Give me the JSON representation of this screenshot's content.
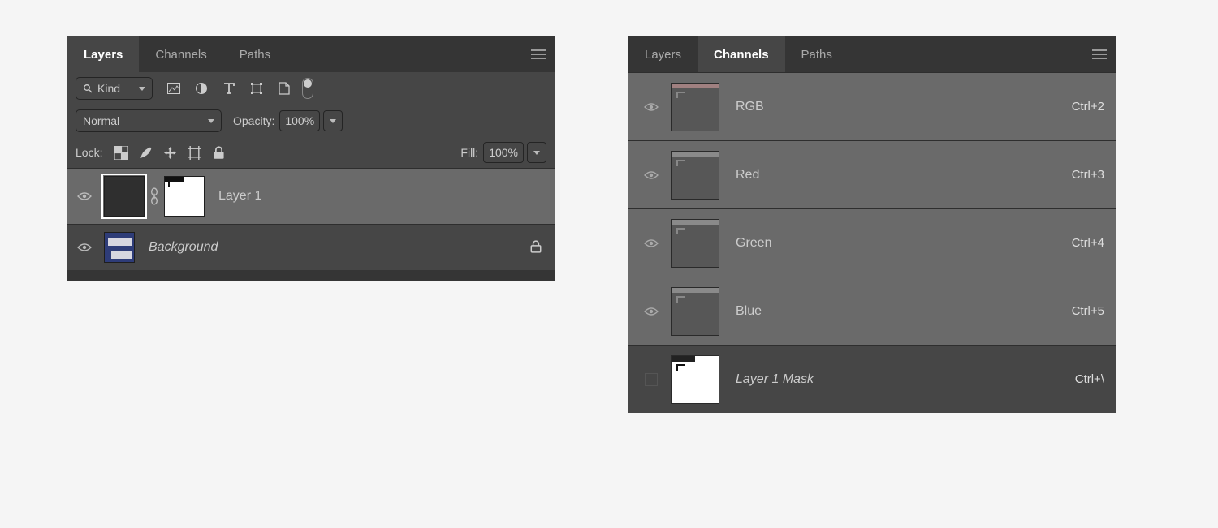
{
  "left": {
    "tabs": [
      "Layers",
      "Channels",
      "Paths"
    ],
    "active_tab_index": 0,
    "filter": {
      "kind_label": "Kind",
      "pixel_icon": "pixel-layer-icon",
      "adjust_icon": "adjustment-layer-icon",
      "type_icon": "type-layer-icon",
      "shape_icon": "shape-layer-icon",
      "smart_icon": "smart-object-icon"
    },
    "blend_row": {
      "mode": "Normal",
      "opacity_label": "Opacity:",
      "opacity_value": "100%"
    },
    "lock_row": {
      "label": "Lock:",
      "fill_label": "Fill:",
      "fill_value": "100%"
    },
    "layers": [
      {
        "name": "Layer 1",
        "italic": false,
        "selected": true,
        "locked": false,
        "mask": true
      },
      {
        "name": "Background",
        "italic": true,
        "selected": false,
        "locked": true,
        "mask": false
      }
    ]
  },
  "right": {
    "tabs": [
      "Layers",
      "Channels",
      "Paths"
    ],
    "active_tab_index": 1,
    "channels": [
      {
        "name": "RGB",
        "shortcut": "Ctrl+2",
        "visible": true,
        "selected": true,
        "italic": false,
        "thumb": "rgb"
      },
      {
        "name": "Red",
        "shortcut": "Ctrl+3",
        "visible": true,
        "selected": true,
        "italic": false,
        "thumb": "mono"
      },
      {
        "name": "Green",
        "shortcut": "Ctrl+4",
        "visible": true,
        "selected": true,
        "italic": false,
        "thumb": "mono"
      },
      {
        "name": "Blue",
        "shortcut": "Ctrl+5",
        "visible": true,
        "selected": true,
        "italic": false,
        "thumb": "mono"
      },
      {
        "name": "Layer 1 Mask",
        "shortcut": "Ctrl+\\",
        "visible": false,
        "selected": false,
        "italic": true,
        "thumb": "mask"
      }
    ]
  }
}
